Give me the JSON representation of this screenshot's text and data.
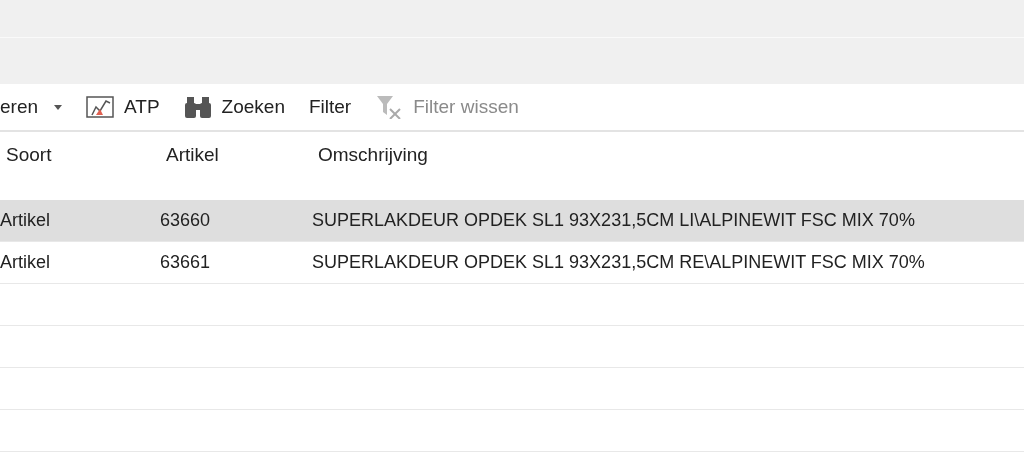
{
  "toolbar": [
    {
      "label": "eren",
      "kind": "dropdown",
      "disabled": false
    },
    {
      "label": "ATP",
      "kind": "chart",
      "disabled": false
    },
    {
      "label": "Zoeken",
      "kind": "search",
      "disabled": false
    },
    {
      "label": "Filter",
      "kind": "plain",
      "disabled": false
    },
    {
      "label": "Filter wissen",
      "kind": "clear",
      "disabled": true
    }
  ],
  "table": {
    "columns": [
      "Soort",
      "Artikel",
      "Omschrijving"
    ],
    "rows": [
      {
        "cells": [
          "Artikel",
          "63660",
          "SUPERLAKDEUR OPDEK SL1 93X231,5CM LI\\ALPINEWIT FSC MIX 70%"
        ],
        "selected": true
      },
      {
        "cells": [
          "Artikel",
          "63661",
          "SUPERLAKDEUR OPDEK SL1 93X231,5CM RE\\ALPINEWIT FSC MIX 70%"
        ],
        "selected": false
      }
    ]
  }
}
